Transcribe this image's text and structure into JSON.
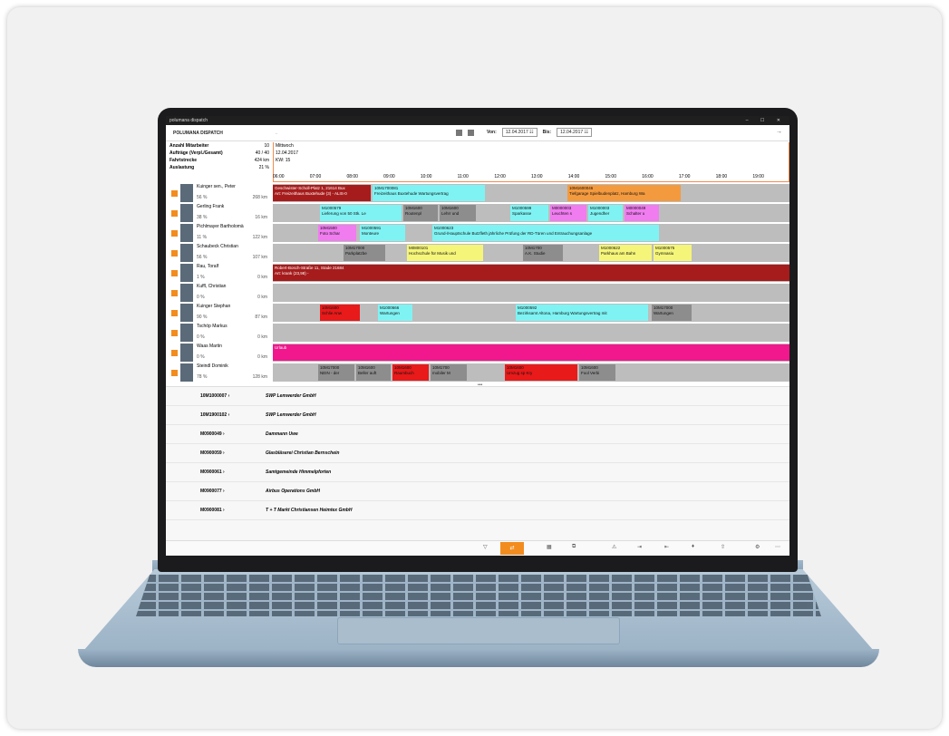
{
  "window": {
    "title": "polumana dispatch",
    "controls": "–  ☐  ✕"
  },
  "app": {
    "title": "POLUMANA DISPATCH",
    "back": "←",
    "forward": "→"
  },
  "toolbar": {
    "from_label": "Von:",
    "from_value": "12.04.2017",
    "to_label": "Bis:",
    "to_value": "12.04.2017",
    "calendar_icon": "☷"
  },
  "stats": [
    {
      "label": "Anzahl Mitarbeiter",
      "value": "10"
    },
    {
      "label": "Aufträge (Verpl./Gesamt)",
      "value": "40 / 40"
    },
    {
      "label": "Fahrtstrecke",
      "value": "424 km"
    },
    {
      "label": "Auslastung",
      "value": "21 %"
    }
  ],
  "day": {
    "weekday": "Mittwoch",
    "date": "12.04.2017",
    "week": "KW: 15"
  },
  "hours": [
    "06:00",
    "07:00",
    "08:00",
    "09:00",
    "10:00",
    "11:00",
    "12:00",
    "13:00",
    "14:00",
    "15:00",
    "16:00",
    "17:00",
    "18:00",
    "19:00"
  ],
  "employees": [
    {
      "name": "Kuinger sen., Peter",
      "pct": "56 %",
      "km": "268 km"
    },
    {
      "name": "Gerling Frank",
      "pct": "38 %",
      "km": "16 km"
    },
    {
      "name": "Pichlmayer Bartholomä",
      "pct": "11 %",
      "km": "122 km"
    },
    {
      "name": "Schaubeck Christian",
      "pct": "56 %",
      "km": "107 km"
    },
    {
      "name": "Rau, Toralf",
      "pct": "1 %",
      "km": "0 km"
    },
    {
      "name": "Kuffl, Christian",
      "pct": "0 %",
      "km": "0 km"
    },
    {
      "name": "Kuinger Stephan",
      "pct": "90 %",
      "km": "87 km"
    },
    {
      "name": "Tschöp Markus",
      "pct": "0 %",
      "km": "0 km"
    },
    {
      "name": "Waas Martin",
      "pct": "0 %",
      "km": "0 km"
    },
    {
      "name": "Steindl Dominik",
      "pct": "78 %",
      "km": "128 km"
    }
  ],
  "bars": {
    "r0a": "Geschwister-Scholl-Platz 1, 21614 Bux\nArt: Freizeithaus Buxtehude (3) - ALIS-0",
    "r0b": "10M1700081\nFreizeithaus Buxtehude Wartungsvertrag",
    "r0c": "10M1600046\nTiefgarage Spielbudenplatz, Hamburg Wa",
    "r1a": "M1000579\nLieferung von 50 Stk. Le",
    "r1b": "10M1600\nRoutenpl",
    "r1c": "10M1600\nLehrr und",
    "r1d": "M1000599\nSparkasse",
    "r1e": "M0000003\nLeuchten s",
    "r1f": "M1000003\nJugendher",
    "r1g": "M0000049\nSchalter u",
    "r2a": "10M1500\nFoto Schar",
    "r2b": "M1000591\nMonteure",
    "r2c": "M1000623\nGrund-/Hauptschule Butzfleth jährliche Prüfung der RD-Türen und Entrauchungsanlage",
    "r3a": "10M17000\nParkplatzbe",
    "r3b": "M0800101\nHochschule für Musik und",
    "r3c": "10M1700\nA.K. Studie",
    "r3d": "M1000622\nParkhaus am Bahn",
    "r3e": "M1000575\nGymnasiu",
    "r4a": "Robert-Bosch-Straße 11, Stade 21684\nArt: krank (23,98) -",
    "r6a": "10M1600\nSchlie Anw",
    "r6b": "M1000666\nWartungen",
    "r6c": "M1000592\nBezirksamt Altona, Hamburg Wartungsvertrag mit",
    "r6d": "10M17000\nWartungen",
    "r8a": "Urlaub",
    "r9a": "10M17000\nNEIN - der",
    "r9b": "10M1600\nBeller auft",
    "r9c": "10M1600\nRaumbuch",
    "r9d": "10M1700\nmobiler M",
    "r9e": "10M1600\nUmzug sp Kry",
    "r9f": "10M1600\nFool Verbi"
  },
  "details": [
    {
      "code": "10M1000007",
      "name": "SWP Lemwerder GmbH"
    },
    {
      "code": "10M1900102",
      "name": "SWP Lemwerder GmbH"
    },
    {
      "code": "M0900049",
      "name": "Dammann Uwe"
    },
    {
      "code": "M0900059",
      "name": "Glasbläserei Christian Bernschein"
    },
    {
      "code": "M0900061",
      "name": "Samtgemeinde Himmelpforten"
    },
    {
      "code": "M0900077",
      "name": "Airbus Operations GmbH"
    },
    {
      "code": "M0900081",
      "name": "T + T Markt Christiansen Heimtex GmbH"
    }
  ],
  "chevron": "›",
  "splitter": "•••"
}
